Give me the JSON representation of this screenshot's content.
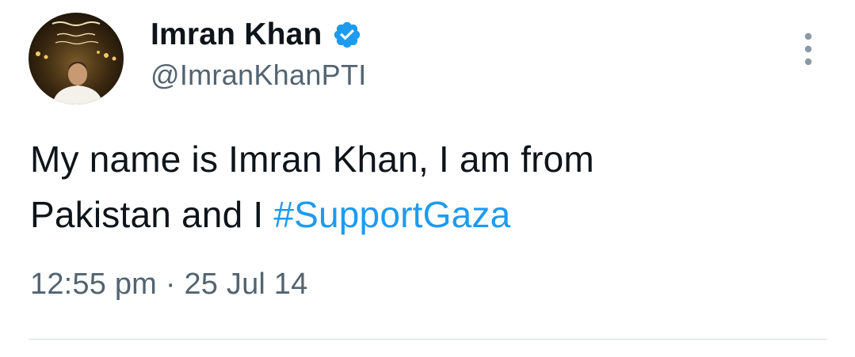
{
  "author": {
    "display_name": "Imran Khan",
    "handle": "@ImranKhanPTI",
    "verified_icon": "verified-badge-icon",
    "avatar_icon": "profile-photo"
  },
  "menu": {
    "icon": "more-vertical-icon"
  },
  "tweet": {
    "text_part1": "My name is Imran Khan, I am from",
    "text_part2": "Pakistan and I ",
    "hashtag": "#SupportGaza"
  },
  "meta": {
    "time": "12:55 pm",
    "separator": "·",
    "date": "25 Jul 14"
  },
  "colors": {
    "accent": "#1d9bf0",
    "muted_text": "#536471",
    "primary_text": "#0f1419"
  }
}
